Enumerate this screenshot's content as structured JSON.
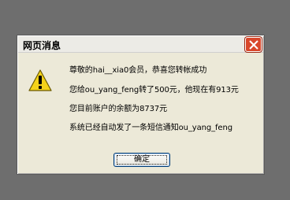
{
  "dialog": {
    "title": "网页消息",
    "icon": "warning-icon",
    "messages": [
      "尊敬的hai__xia0会员，恭喜您转帐成功",
      "您给ou_yang_feng转了500元，他现在有913元",
      "您目前账户的余额为8737元",
      "系统已经自动发了一条短信通知ou_yang_feng"
    ],
    "ok_label": "确定"
  },
  "colors": {
    "close_button": "#d9472b",
    "warning_yellow": "#f4d21a"
  }
}
